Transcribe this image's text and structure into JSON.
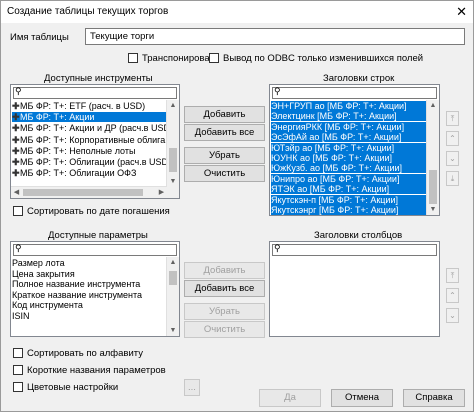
{
  "window": {
    "title": "Создание таблицы текущих торгов",
    "close": "✕"
  },
  "name": {
    "label": "Имя таблицы",
    "value": "Текущие торги"
  },
  "options": {
    "transpose": "Транспонировать",
    "odbc": "Вывод по ODBC только изменившихся  полей",
    "sort_by_expiry": "Сортировать по дате погашения",
    "sort_alpha": "Сортировать по алфавиту",
    "short_names": "Короткие названия параметров",
    "color_settings": "Цветовые настройки"
  },
  "instruments": {
    "title": "Доступные инструменты",
    "items": [
      "МБ ФР: Т+: ETF (расч. в USD)",
      "МБ ФР: Т+: Акции",
      "МБ ФР: Т+: Акции и ДР (расч.в USD",
      "МБ ФР: Т+: Корпоративные облига",
      "МБ ФР: Т+: Неполные лоты",
      "МБ ФР: Т+: Облигации (расч.в USD",
      "МБ ФР: Т+: Облигации ОФЗ"
    ]
  },
  "row_headers": {
    "title": "Заголовки строк",
    "items": [
      "ЭН+ГРУП ао [МБ ФР: Т+: Акции]",
      "Электцинк [МБ ФР: Т+: Акции]",
      "ЭнергияРКК [МБ ФР: Т+: Акции]",
      "ЭсЭфАй ао [МБ ФР: Т+: Акции]",
      "ЮТэйр ао [МБ ФР: Т+: Акции]",
      "ЮУНК ао [МБ ФР: Т+: Акции]",
      "ЮжКузб. ао [МБ ФР: Т+: Акции]",
      "Юнипро ао [МБ ФР: Т+: Акции]",
      "ЯТЭК ао [МБ ФР: Т+: Акции]",
      "Якутскэн-п [МБ ФР: Т+: Акции]",
      "Якутскэнрг [МБ ФР: Т+: Акции]"
    ]
  },
  "parameters": {
    "title": "Доступные параметры",
    "items": [
      "Размер лота",
      "Цена закрытия",
      "Полное название инструмента",
      "Краткое название инструмента",
      "Код инструмента",
      "ISIN"
    ]
  },
  "col_headers": {
    "title": "Заголовки столбцов",
    "items": []
  },
  "buttons": {
    "add": "Добавить",
    "add_all": "Добавить все",
    "remove": "Убрать",
    "clear": "Очистить",
    "ok": "Да",
    "cancel": "Отмена",
    "help": "Справка",
    "more": "..."
  },
  "icons": {
    "search": "⚲",
    "top": "⤒",
    "up": "⌃",
    "down": "⌄",
    "bottom": "⤓"
  }
}
